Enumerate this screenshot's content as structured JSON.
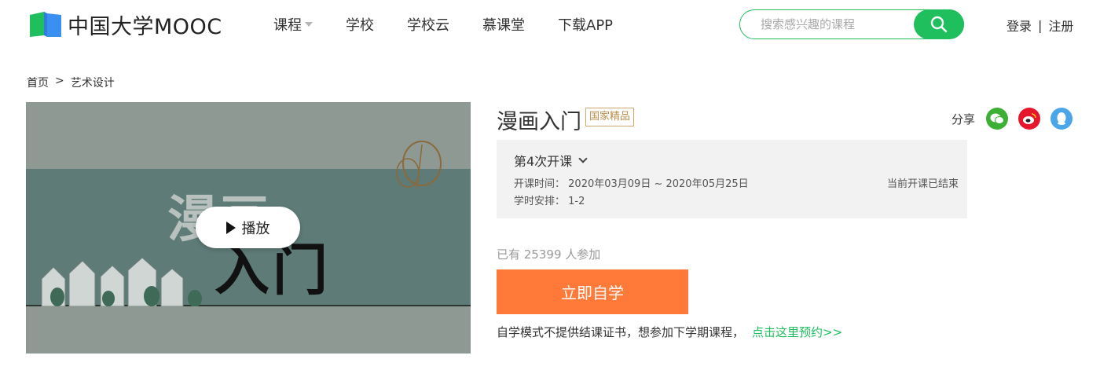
{
  "header": {
    "logo_text": "中国大学MOOC",
    "nav": [
      {
        "label": "课程",
        "has_caret": true
      },
      {
        "label": "学校"
      },
      {
        "label": "学校云"
      },
      {
        "label": "慕课堂"
      },
      {
        "label": "下载APP"
      }
    ],
    "search": {
      "placeholder": "搜索感兴趣的课程",
      "value": ""
    },
    "auth": {
      "login": "登录",
      "separator": "|",
      "register": "注册"
    }
  },
  "breadcrumb": {
    "home": "首页",
    "separator": ">",
    "category": "艺术设计"
  },
  "cover": {
    "title_line1": "漫画",
    "title_line2": "入门",
    "play_label": "播放"
  },
  "course": {
    "title": "漫画入门",
    "badge": "国家精品",
    "share_label": "分享",
    "share_icons": [
      "wechat-icon",
      "weibo-icon",
      "qq-icon"
    ],
    "session": {
      "title": "第4次开课",
      "time_label": "开课时间：",
      "time_value": "2020年03月09日 ~ 2020年05月25日",
      "schedule_label": "学时安排：",
      "schedule_value": "1-2",
      "status": "当前开课已结束"
    },
    "enrolled_text": "已有 25399 人参加",
    "cta_label": "立即自学",
    "note_text": "自学模式不提供结课证书，想参加下学期课程，",
    "note_link": "点击这里预约>>"
  },
  "colors": {
    "brand_green": "#1fbf5e",
    "cta_orange": "#ff7a39",
    "badge_gold": "#b98d4b",
    "wechat": "#3cb034",
    "weibo": "#e6162d",
    "qq": "#4aa6e8"
  }
}
